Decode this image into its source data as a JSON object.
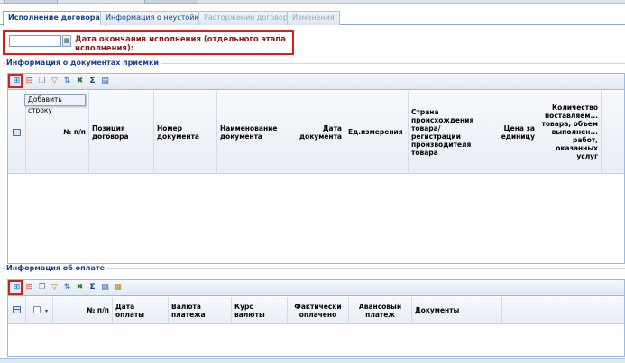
{
  "tabs": [
    {
      "label": "Исполнение договора",
      "state": "active"
    },
    {
      "label": "Информация о неустойках",
      "state": "normal"
    },
    {
      "label": "Расторжение договора",
      "state": "disabled"
    },
    {
      "label": "Изменения",
      "state": "disabled"
    }
  ],
  "completion_date": {
    "value": "",
    "label": "Дата окончания исполнения (отдельного этапа исполнения):"
  },
  "acceptance_docs": {
    "section_title": "Информация о документах приемки",
    "toolbar_icons": [
      "add-row-icon",
      "delete-row-icon",
      "copy-icon",
      "filter-icon",
      "sort-icon",
      "excel-export-icon",
      "sum-icon",
      "columns-icon"
    ],
    "tooltip": "Добавить строку",
    "columns": [
      "№ п/п",
      "Позиция договора",
      "Номер документа",
      "Наименование документа",
      "Дата документа",
      "Ед.измерения",
      "Страна происхождения товара/ регистрации производителя товара",
      "Цена за единицу",
      "Количество поставляем... товара, объем выполнен... работ, оказанных услуг"
    ]
  },
  "payment_info": {
    "section_title": "Информация об оплате",
    "toolbar_icons": [
      "add-row-icon",
      "delete-row-icon",
      "copy-icon",
      "filter-icon",
      "sort-icon",
      "excel-export-icon",
      "sum-icon",
      "columns-icon",
      "table-icon"
    ],
    "columns": [
      "№ п/п",
      "Дата оплаты",
      "Валюта платежа",
      "Курс валюты",
      "Фактически оплачено",
      "Авансовый платеж",
      "Документы"
    ]
  }
}
